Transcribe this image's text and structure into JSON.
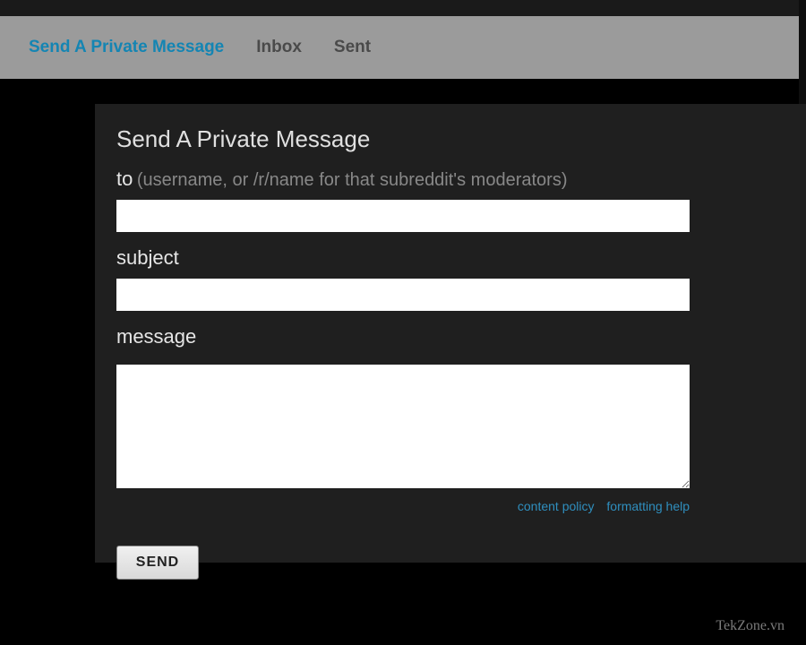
{
  "tabs": {
    "send": "Send A Private Message",
    "inbox": "Inbox",
    "sent": "Sent"
  },
  "form": {
    "title": "Send A Private Message",
    "to_label": "to",
    "to_hint": "(username, or /r/name for that subreddit's moderators)",
    "to_value": "",
    "subject_label": "subject",
    "subject_value": "",
    "message_label": "message",
    "message_value": ""
  },
  "links": {
    "content_policy": "content policy",
    "formatting_help": "formatting help"
  },
  "buttons": {
    "send": "SEND"
  },
  "watermark": "TekZone.vn"
}
